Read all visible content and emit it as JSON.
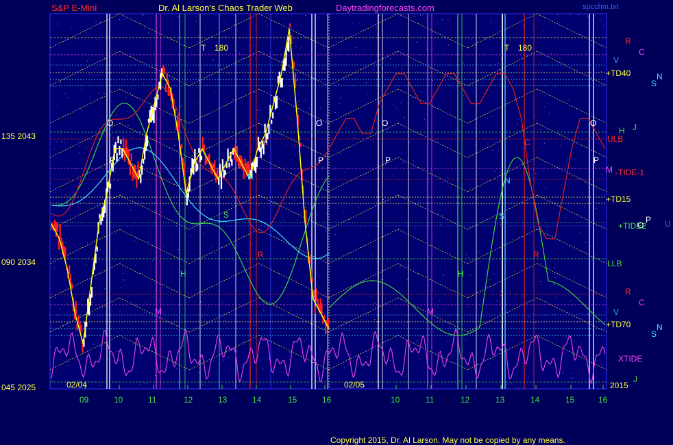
{
  "header": {
    "instrument": "S&P E-Mini",
    "site_title": "Dr. Al Larson's Chaos Trader Web",
    "site_url": "Daytradingforecasts.com",
    "file_name": "spcchm.txt"
  },
  "footer": {
    "copyright": "Copyright 2015, Dr. Al Larson. May not be copied by any means."
  },
  "colors": {
    "background": "#00005a",
    "price_up": "#ffffff",
    "price_down": "#ff2020",
    "price_mid": "#ffff00",
    "tide": "#e02020",
    "xtide": "#e040e0",
    "green_flow": "#40d040",
    "cyan_flow": "#40e0ff",
    "text_red": "#ff3030",
    "text_yellow": "#ffff40",
    "text_magenta": "#ff40ff",
    "text_green": "#40e040"
  },
  "chart_data": {
    "type": "line",
    "y_axis": {
      "range": [
        2025,
        2050
      ],
      "ticks": [
        {
          "label": "045 2025",
          "value": 2025
        },
        {
          "label": "090 2034",
          "value": 2034
        },
        {
          "label": "135 2043",
          "value": 2043
        }
      ]
    },
    "dates": [
      "02/04",
      "02/05"
    ],
    "x_tick_labels": [
      "09",
      "10",
      "11",
      "12",
      "13",
      "14",
      "15",
      "16",
      "10",
      "11",
      "12",
      "13",
      "14",
      "15",
      "16"
    ],
    "markers": {
      "T_label": "T",
      "T_value": "180",
      "letters": [
        "O",
        "P",
        "M",
        "H",
        "S",
        "R",
        "N",
        "C",
        "O",
        "P",
        "M",
        "H",
        "N",
        "S",
        "C",
        "O",
        "P"
      ]
    },
    "right_labels": [
      {
        "text": "R",
        "color": "#ff3030"
      },
      {
        "text": "C",
        "color": "#ff40ff"
      },
      {
        "text": "V",
        "color": "#40a0ff"
      },
      {
        "text": "+TD40",
        "color": "#ffff40"
      },
      {
        "text": "N",
        "color": "#40e0ff"
      },
      {
        "text": "S",
        "color": "#40e0ff"
      },
      {
        "text": "H",
        "color": "#40e040"
      },
      {
        "text": "J",
        "color": "#40e040"
      },
      {
        "text": "ULB",
        "color": "#ff3030"
      },
      {
        "text": "M",
        "color": "#ff40ff"
      },
      {
        "text": "-TIDE-1",
        "color": "#ff3030"
      },
      {
        "text": "+TD15",
        "color": "#ffff40"
      },
      {
        "text": "+TIDE2",
        "color": "#40e040"
      },
      {
        "text": "O",
        "color": "#ffffff"
      },
      {
        "text": "P",
        "color": "#ffffff"
      },
      {
        "text": "U",
        "color": "#4060ff"
      },
      {
        "text": "LLB",
        "color": "#40e040"
      },
      {
        "text": "R",
        "color": "#ff3030"
      },
      {
        "text": "C",
        "color": "#ff40ff"
      },
      {
        "text": "V",
        "color": "#40a0ff"
      },
      {
        "text": "+TD70",
        "color": "#ffff40"
      },
      {
        "text": "N",
        "color": "#40e0ff"
      },
      {
        "text": "S",
        "color": "#40e0ff"
      },
      {
        "text": "XTIDE",
        "color": "#ff40ff"
      },
      {
        "text": "2015",
        "color": "#ffff40"
      },
      {
        "text": "J",
        "color": "#40e040"
      }
    ],
    "series": [
      {
        "name": "",
        "role": "price_close",
        "values": [
          2036,
          2035,
          2033,
          2030,
          2028,
          2032,
          2036,
          2038,
          2041,
          2041,
          2040,
          2039,
          2042,
          2044,
          2046,
          2045,
          2042,
          2038,
          2040,
          2041,
          2040,
          2039,
          2040,
          2041,
          2040,
          2039,
          2041,
          2042,
          2044,
          2046,
          2049,
          2043,
          2036,
          2031,
          2030,
          2029
        ]
      },
      {
        "name": "",
        "role": "tide_projection",
        "values": [
          2041,
          2042,
          2043,
          2043,
          2042,
          2042,
          2044,
          2045,
          2046,
          2046,
          2045,
          2044,
          2044,
          2045,
          2046,
          2046,
          2045,
          2044,
          2044,
          2045,
          2046,
          2046,
          2045,
          2043,
          2039,
          2036,
          2035,
          2035,
          2038,
          2041,
          2043,
          2043,
          2042,
          2041
        ]
      }
    ]
  }
}
